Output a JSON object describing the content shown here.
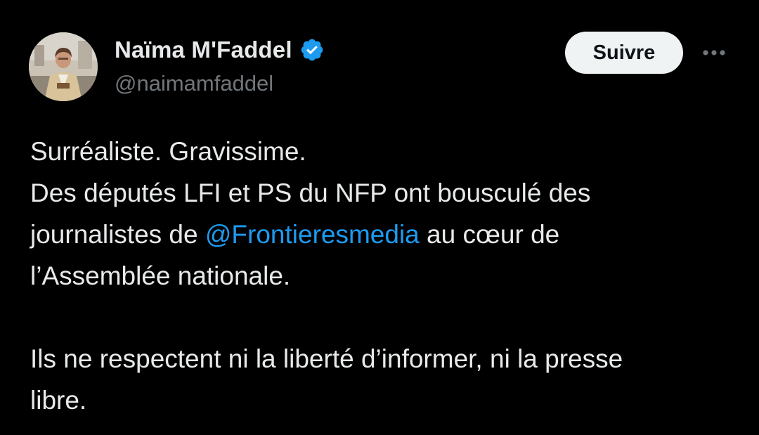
{
  "author": {
    "display_name": "Naïma M'Faddel",
    "handle": "@naimamfaddel",
    "verified": true,
    "avatar_icon": "profile-photo"
  },
  "actions": {
    "follow_label": "Suivre",
    "more_icon": "more-horizontal-icon"
  },
  "tweet": {
    "line1": "Surréaliste. Gravissime.",
    "line2": "Des députés LFI et PS du NFP ont bousculé des",
    "line3_before": "journalistes de ",
    "mention": "@Frontieresmedia",
    "line3_after": " au cœur de",
    "line4": "l’Assemblée nationale.",
    "line5": "Ils ne respectent ni la liberté d’informer, ni la presse",
    "line6": "libre."
  },
  "colors": {
    "background": "#000000",
    "text_primary": "#e7e9ea",
    "text_secondary": "#71767b",
    "link": "#1d9bf0",
    "verified_badge": "#1d9bf0",
    "follow_button_bg": "#eff3f4"
  }
}
